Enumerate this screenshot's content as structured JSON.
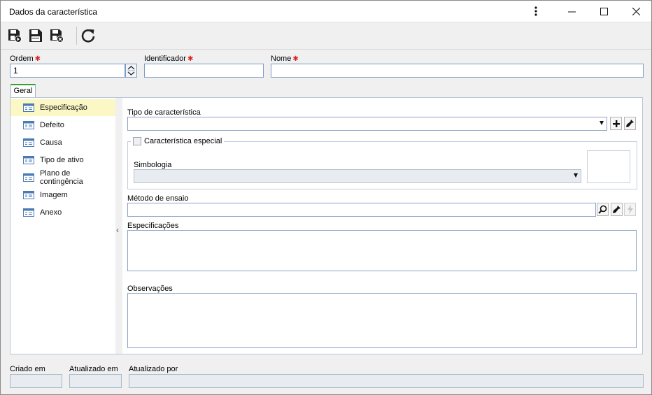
{
  "window": {
    "title": "Dados da característica"
  },
  "toolbar": {
    "buttons": [
      "save-and-new-icon",
      "save-icon",
      "save-and-close-icon",
      "refresh-icon"
    ]
  },
  "header_fields": {
    "ordem_label": "Ordem",
    "ordem_value": "1",
    "identificador_label": "Identificador",
    "identificador_value": "",
    "nome_label": "Nome",
    "nome_value": ""
  },
  "tabs": [
    {
      "label": "Geral",
      "selected": true
    }
  ],
  "sidebar": {
    "items": [
      {
        "label": "Especificação",
        "selected": true
      },
      {
        "label": "Defeito"
      },
      {
        "label": "Causa"
      },
      {
        "label": "Tipo de ativo"
      },
      {
        "label": "Plano de contingência"
      },
      {
        "label": "Imagem"
      },
      {
        "label": "Anexo"
      }
    ]
  },
  "form": {
    "tipo_label": "Tipo de característica",
    "tipo_value": "",
    "especial_label": "Característica especial",
    "especial_checked": false,
    "simbologia_label": "Simbologia",
    "simbologia_value": "",
    "metodo_label": "Método de ensaio",
    "metodo_value": "",
    "especificacoes_label": "Especificações",
    "especificacoes_value": "",
    "observacoes_label": "Observações",
    "observacoes_value": ""
  },
  "footer": {
    "criado_em_label": "Criado em",
    "criado_em_value": "",
    "atualizado_em_label": "Atualizado em",
    "atualizado_em_value": "",
    "atualizado_por_label": "Atualizado por",
    "atualizado_por_value": ""
  },
  "colors": {
    "required_marker": "#dd2222",
    "selected_item_bg": "#fbf8c6",
    "tab_accent": "#39a030",
    "input_border": "#7a9cc6"
  }
}
